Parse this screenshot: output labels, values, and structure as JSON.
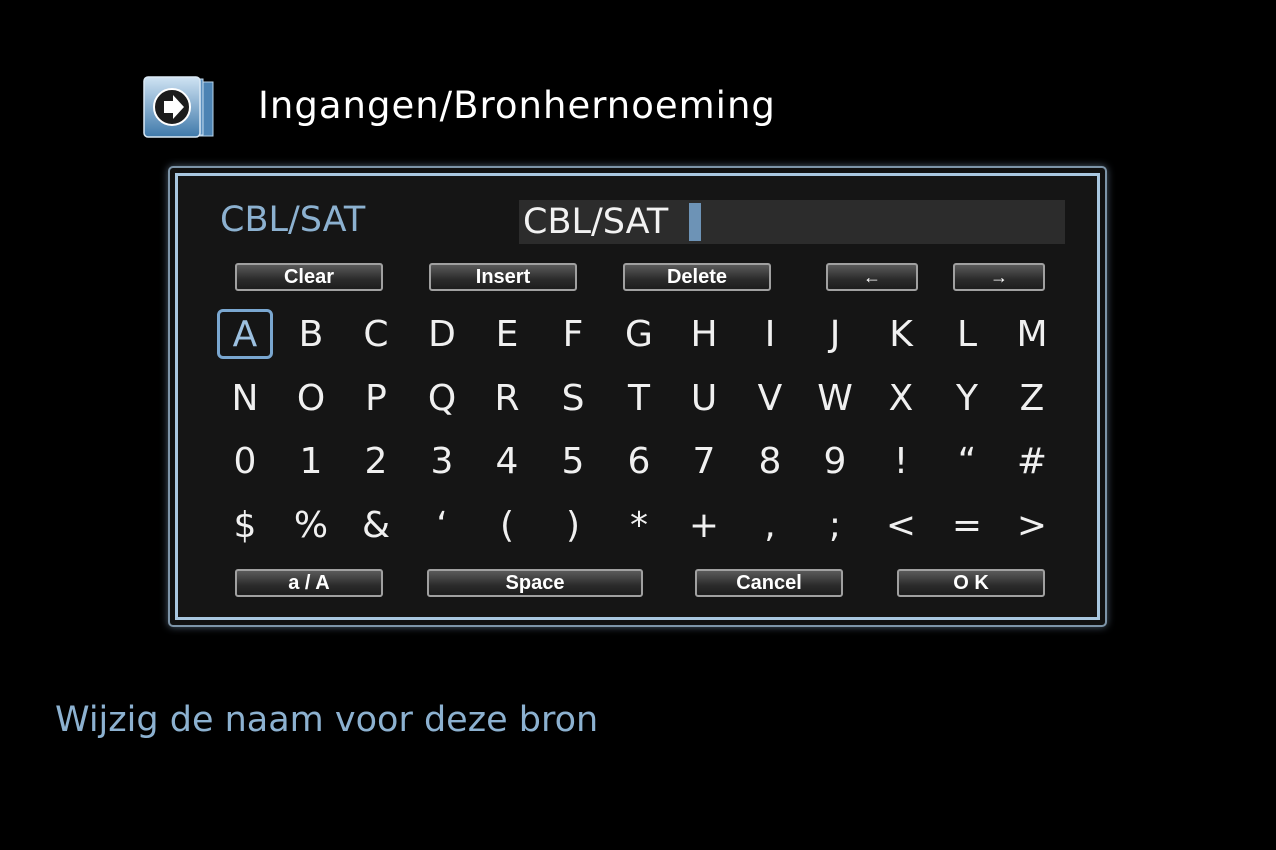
{
  "header": {
    "title": "Ingangen/Bronhernoeming",
    "icon": "input-arrow-icon"
  },
  "editor": {
    "field_label": "CBL/SAT",
    "input_value": "CBL/SAT"
  },
  "top_buttons": {
    "clear": "Clear",
    "insert": "Insert",
    "delete": "Delete",
    "left": "←",
    "right": "→"
  },
  "keys": [
    [
      "A",
      "B",
      "C",
      "D",
      "E",
      "F",
      "G",
      "H",
      "I",
      "J",
      "K",
      "L",
      "M"
    ],
    [
      "N",
      "O",
      "P",
      "Q",
      "R",
      "S",
      "T",
      "U",
      "V",
      "W",
      "X",
      "Y",
      "Z"
    ],
    [
      "0",
      "1",
      "2",
      "3",
      "4",
      "5",
      "6",
      "7",
      "8",
      "9",
      "!",
      "“",
      "#"
    ],
    [
      "$",
      "%",
      "&",
      "‘",
      "(",
      ")",
      "*",
      "+",
      ",",
      ";",
      "<",
      "=",
      ">"
    ]
  ],
  "selected_key": "A",
  "bottom_buttons": {
    "case": "a / A",
    "space": "Space",
    "cancel": "Cancel",
    "ok": "O K"
  },
  "hint": "Wijzig de naam voor deze bron",
  "colors": {
    "accent": "#8cb1d0",
    "background": "#000000",
    "frame": "#a9c7e0"
  }
}
